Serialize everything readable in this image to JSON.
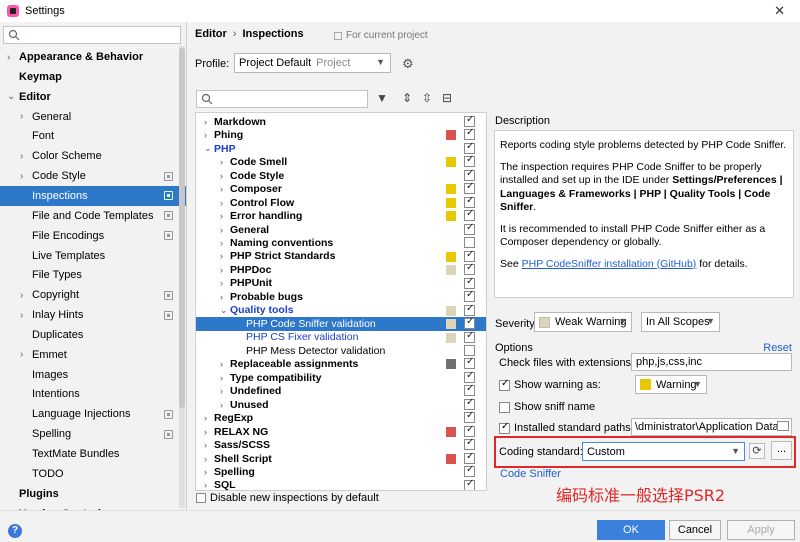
{
  "window": {
    "title": "Settings",
    "close_glyph": "✕"
  },
  "sidebar": {
    "search_placeholder": "",
    "items": [
      {
        "label": "Appearance & Behavior",
        "arrow": "›",
        "bold": true
      },
      {
        "label": "Keymap",
        "arrow": "",
        "bold": true
      },
      {
        "label": "Editor",
        "arrow": "⌄",
        "bold": true
      },
      {
        "label": "General",
        "arrow": "›"
      },
      {
        "label": "Font",
        "arrow": ""
      },
      {
        "label": "Color Scheme",
        "arrow": "›"
      },
      {
        "label": "Code Style",
        "arrow": "›",
        "proj": true
      },
      {
        "label": "Inspections",
        "arrow": "",
        "proj": true,
        "selected": true
      },
      {
        "label": "File and Code Templates",
        "arrow": "",
        "proj": true
      },
      {
        "label": "File Encodings",
        "arrow": "",
        "proj": true
      },
      {
        "label": "Live Templates",
        "arrow": ""
      },
      {
        "label": "File Types",
        "arrow": ""
      },
      {
        "label": "Copyright",
        "arrow": "›",
        "proj": true
      },
      {
        "label": "Inlay Hints",
        "arrow": "›",
        "proj": true
      },
      {
        "label": "Duplicates",
        "arrow": ""
      },
      {
        "label": "Emmet",
        "arrow": "›"
      },
      {
        "label": "Images",
        "arrow": ""
      },
      {
        "label": "Intentions",
        "arrow": ""
      },
      {
        "label": "Language Injections",
        "arrow": "",
        "proj": true
      },
      {
        "label": "Spelling",
        "arrow": "",
        "proj": true
      },
      {
        "label": "TextMate Bundles",
        "arrow": ""
      },
      {
        "label": "TODO",
        "arrow": ""
      },
      {
        "label": "Plugins",
        "arrow": "",
        "bold": true
      },
      {
        "label": "Version Control",
        "arrow": "›",
        "bold": true
      }
    ]
  },
  "header": {
    "crumb1": "Editor",
    "sep": "›",
    "crumb2": "Inspections",
    "for_project": "For current project"
  },
  "profile": {
    "label": "Profile:",
    "value": "Project Default",
    "sub": "Project"
  },
  "filter": {
    "placeholder": ""
  },
  "tree": [
    {
      "label": "Markdown",
      "lvl": 0,
      "arrow": "›",
      "bold": true,
      "swatch": "",
      "checked": true
    },
    {
      "label": "Phing",
      "lvl": 0,
      "arrow": "›",
      "bold": true,
      "swatch": "#d9534f",
      "checked": true
    },
    {
      "label": "PHP",
      "lvl": 0,
      "arrow": "⌄",
      "bold": true,
      "blue": true,
      "swatch": "",
      "checked": true
    },
    {
      "label": "Code Smell",
      "lvl": 1,
      "arrow": "›",
      "bold": true,
      "swatch": "#e8c800",
      "checked": true
    },
    {
      "label": "Code Style",
      "lvl": 1,
      "arrow": "›",
      "bold": true,
      "swatch": "",
      "checked": true
    },
    {
      "label": "Composer",
      "lvl": 1,
      "arrow": "›",
      "bold": true,
      "swatch": "#e8c800",
      "checked": true
    },
    {
      "label": "Control Flow",
      "lvl": 1,
      "arrow": "›",
      "bold": true,
      "swatch": "#e8c800",
      "checked": true
    },
    {
      "label": "Error handling",
      "lvl": 1,
      "arrow": "›",
      "bold": true,
      "swatch": "#e8c800",
      "checked": true
    },
    {
      "label": "General",
      "lvl": 1,
      "arrow": "›",
      "bold": true,
      "swatch": "",
      "checked": true
    },
    {
      "label": "Naming conventions",
      "lvl": 1,
      "arrow": "›",
      "bold": true,
      "swatch": "",
      "checked": false
    },
    {
      "label": "PHP Strict Standards",
      "lvl": 1,
      "arrow": "›",
      "bold": true,
      "swatch": "#e8c800",
      "checked": true
    },
    {
      "label": "PHPDoc",
      "lvl": 1,
      "arrow": "›",
      "bold": true,
      "swatch": "#ddd5b8",
      "checked": true
    },
    {
      "label": "PHPUnit",
      "lvl": 1,
      "arrow": "›",
      "bold": true,
      "swatch": "",
      "checked": true
    },
    {
      "label": "Probable bugs",
      "lvl": 1,
      "arrow": "›",
      "bold": true,
      "swatch": "",
      "checked": true
    },
    {
      "label": "Quality tools",
      "lvl": 1,
      "arrow": "⌄",
      "bold": true,
      "blue": true,
      "swatch": "#ddd5b8",
      "checked": true
    },
    {
      "label": "PHP Code Sniffer validation",
      "lvl": 2,
      "arrow": "",
      "swatch": "#ddd5b8",
      "checked": true,
      "selected": true
    },
    {
      "label": "PHP CS Fixer validation",
      "lvl": 2,
      "arrow": "",
      "blue": true,
      "swatch": "#ddd5b8",
      "checked": true
    },
    {
      "label": "PHP Mess Detector validation",
      "lvl": 2,
      "arrow": "",
      "swatch": "",
      "checked": false
    },
    {
      "label": "Replaceable assignments",
      "lvl": 1,
      "arrow": "›",
      "bold": true,
      "swatch": "#707070",
      "checked": true
    },
    {
      "label": "Type compatibility",
      "lvl": 1,
      "arrow": "›",
      "bold": true,
      "swatch": "",
      "checked": true
    },
    {
      "label": "Undefined",
      "lvl": 1,
      "arrow": "›",
      "bold": true,
      "swatch": "",
      "checked": true
    },
    {
      "label": "Unused",
      "lvl": 1,
      "arrow": "›",
      "bold": true,
      "swatch": "",
      "checked": true
    },
    {
      "label": "RegExp",
      "lvl": 0,
      "arrow": "›",
      "bold": true,
      "swatch": "",
      "checked": true
    },
    {
      "label": "RELAX NG",
      "lvl": 0,
      "arrow": "›",
      "bold": true,
      "swatch": "#d9534f",
      "checked": true
    },
    {
      "label": "Sass/SCSS",
      "lvl": 0,
      "arrow": "›",
      "bold": true,
      "swatch": "",
      "checked": true
    },
    {
      "label": "Shell Script",
      "lvl": 0,
      "arrow": "›",
      "bold": true,
      "swatch": "#d9534f",
      "checked": true
    },
    {
      "label": "Spelling",
      "lvl": 0,
      "arrow": "›",
      "bold": true,
      "swatch": "",
      "checked": true
    },
    {
      "label": "SQL",
      "lvl": 0,
      "arrow": "›",
      "bold": true,
      "swatch": "",
      "checked": true
    }
  ],
  "disable_new": "Disable new inspections by default",
  "description": {
    "label": "Description",
    "p1": "Reports coding style problems detected by PHP Code Sniffer.",
    "p2a": "The inspection requires PHP Code Sniffer to be properly installed and set up in the IDE under ",
    "p2b": "Settings/Preferences | Languages & Frameworks | PHP | Quality Tools | Code Sniffer",
    "p2c": ".",
    "p3": "It is recommended to install PHP Code Sniffer either as a Composer dependency or globally.",
    "p4a": "See ",
    "p4link": "PHP CodeSniffer installation (GitHub)",
    "p4b": " for details."
  },
  "severity": {
    "label": "Severity:",
    "value": "Weak Warning",
    "scope": "In All Scopes"
  },
  "options": {
    "label": "Options",
    "reset": "Reset",
    "ext_label": "Check files with extensions:",
    "ext_value": "php,js,css,inc",
    "show_warning": "Show warning as:",
    "warning_value": "Warning",
    "show_sniff": "Show sniff name",
    "installed_paths": "Installed standard paths:",
    "path_value": "\\dministrator\\Application Data",
    "coding_label": "Coding standard:",
    "coding_value": "Custom",
    "dots": "...",
    "cs_link": "Code Sniffer"
  },
  "annotation": "编码标准一般选择PSR2",
  "footer": {
    "help": "?",
    "ok": "OK",
    "cancel": "Cancel",
    "apply": "Apply"
  }
}
